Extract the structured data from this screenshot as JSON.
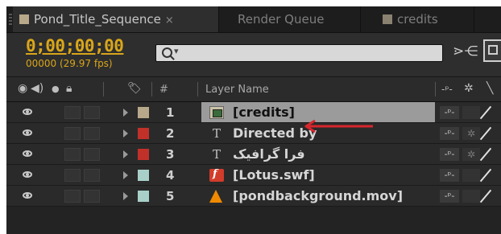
{
  "tabs": [
    {
      "label": "Pond_Title_Sequence",
      "active": true,
      "close": "×"
    },
    {
      "label": "Render Queue",
      "active": false
    },
    {
      "label": "credits",
      "active": false
    }
  ],
  "toolbar": {
    "timecode": "0;00;00;00",
    "frames": "00000 (29.97 fps)",
    "search_dropdown": "▾"
  },
  "header": {
    "number": "#",
    "layer_name": "Layer Name"
  },
  "layers": [
    {
      "num": "1",
      "name": "[credits]",
      "type": "composition",
      "label_color": "#b8a98a",
      "selected": true
    },
    {
      "num": "2",
      "name": "Directed by",
      "type": "text",
      "label_color": "#c2302a",
      "selected": false
    },
    {
      "num": "3",
      "name": "فرا گرافیک",
      "type": "text",
      "label_color": "#c2302a",
      "selected": false
    },
    {
      "num": "4",
      "name": "[Lotus.swf]",
      "type": "swf",
      "label_color": "#a8d0c8",
      "selected": false
    },
    {
      "num": "5",
      "name": "[pondbackground.mov]",
      "type": "video",
      "label_color": "#a8d0c8",
      "selected": false
    }
  ],
  "annotation": {
    "arrow_color": "#d7262c"
  }
}
